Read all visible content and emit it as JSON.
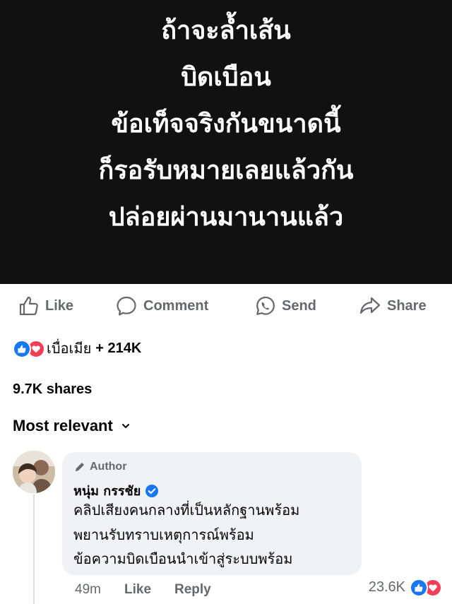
{
  "post_image": {
    "lines": [
      "ถ้าจะล้ำเส้น",
      "บิดเบือน",
      "ข้อเท็จจริงกันขนาดนี้",
      "ก็รอรับหมายเลยแล้วกัน",
      "ปล่อยผ่านมานานแล้ว"
    ],
    "background_color": "#111111",
    "text_color": "#ffffff"
  },
  "actions": {
    "like": "Like",
    "comment": "Comment",
    "send": "Send",
    "share": "Share"
  },
  "reactions": {
    "icons": [
      "like-reaction-icon",
      "love-reaction-icon"
    ],
    "names": "เบื่อเมีย",
    "count": "+ 214K"
  },
  "shares": "9.7K shares",
  "comments_sort": "Most relevant",
  "comment": {
    "badge": "Author",
    "author": "หนุ่ม กรรชัย",
    "verified": true,
    "text_lines": [
      "คลิปเสียงคนกลางที่เป็นหลักฐานพร้อม",
      "พยานรับทราบเหตุการณ์พร้อม",
      "ข้อความบิดเบือนนำเข้าสู่ระบบพร้อม"
    ],
    "time": "49m",
    "like_label": "Like",
    "reply_label": "Reply",
    "reaction_count": "23.6K"
  },
  "colors": {
    "like_blue": "#1877f2",
    "love_red": "#f33e58",
    "muted": "#65686c",
    "bubble": "#f0f2f5"
  }
}
